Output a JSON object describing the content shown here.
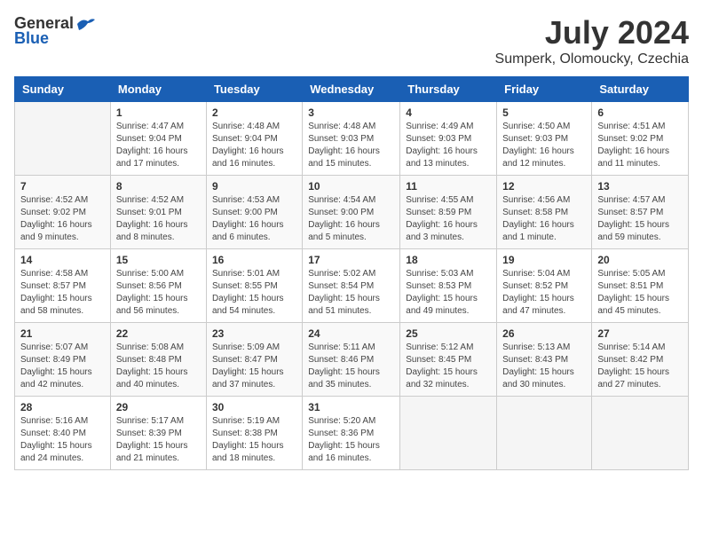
{
  "header": {
    "logo_general": "General",
    "logo_blue": "Blue",
    "month_title": "July 2024",
    "subtitle": "Sumperk, Olomoucky, Czechia"
  },
  "weekdays": [
    "Sunday",
    "Monday",
    "Tuesday",
    "Wednesday",
    "Thursday",
    "Friday",
    "Saturday"
  ],
  "weeks": [
    [
      {
        "day": "",
        "sunrise": "",
        "sunset": "",
        "daylight": ""
      },
      {
        "day": "1",
        "sunrise": "Sunrise: 4:47 AM",
        "sunset": "Sunset: 9:04 PM",
        "daylight": "Daylight: 16 hours and 17 minutes."
      },
      {
        "day": "2",
        "sunrise": "Sunrise: 4:48 AM",
        "sunset": "Sunset: 9:04 PM",
        "daylight": "Daylight: 16 hours and 16 minutes."
      },
      {
        "day": "3",
        "sunrise": "Sunrise: 4:48 AM",
        "sunset": "Sunset: 9:03 PM",
        "daylight": "Daylight: 16 hours and 15 minutes."
      },
      {
        "day": "4",
        "sunrise": "Sunrise: 4:49 AM",
        "sunset": "Sunset: 9:03 PM",
        "daylight": "Daylight: 16 hours and 13 minutes."
      },
      {
        "day": "5",
        "sunrise": "Sunrise: 4:50 AM",
        "sunset": "Sunset: 9:03 PM",
        "daylight": "Daylight: 16 hours and 12 minutes."
      },
      {
        "day": "6",
        "sunrise": "Sunrise: 4:51 AM",
        "sunset": "Sunset: 9:02 PM",
        "daylight": "Daylight: 16 hours and 11 minutes."
      }
    ],
    [
      {
        "day": "7",
        "sunrise": "Sunrise: 4:52 AM",
        "sunset": "Sunset: 9:02 PM",
        "daylight": "Daylight: 16 hours and 9 minutes."
      },
      {
        "day": "8",
        "sunrise": "Sunrise: 4:52 AM",
        "sunset": "Sunset: 9:01 PM",
        "daylight": "Daylight: 16 hours and 8 minutes."
      },
      {
        "day": "9",
        "sunrise": "Sunrise: 4:53 AM",
        "sunset": "Sunset: 9:00 PM",
        "daylight": "Daylight: 16 hours and 6 minutes."
      },
      {
        "day": "10",
        "sunrise": "Sunrise: 4:54 AM",
        "sunset": "Sunset: 9:00 PM",
        "daylight": "Daylight: 16 hours and 5 minutes."
      },
      {
        "day": "11",
        "sunrise": "Sunrise: 4:55 AM",
        "sunset": "Sunset: 8:59 PM",
        "daylight": "Daylight: 16 hours and 3 minutes."
      },
      {
        "day": "12",
        "sunrise": "Sunrise: 4:56 AM",
        "sunset": "Sunset: 8:58 PM",
        "daylight": "Daylight: 16 hours and 1 minute."
      },
      {
        "day": "13",
        "sunrise": "Sunrise: 4:57 AM",
        "sunset": "Sunset: 8:57 PM",
        "daylight": "Daylight: 15 hours and 59 minutes."
      }
    ],
    [
      {
        "day": "14",
        "sunrise": "Sunrise: 4:58 AM",
        "sunset": "Sunset: 8:57 PM",
        "daylight": "Daylight: 15 hours and 58 minutes."
      },
      {
        "day": "15",
        "sunrise": "Sunrise: 5:00 AM",
        "sunset": "Sunset: 8:56 PM",
        "daylight": "Daylight: 15 hours and 56 minutes."
      },
      {
        "day": "16",
        "sunrise": "Sunrise: 5:01 AM",
        "sunset": "Sunset: 8:55 PM",
        "daylight": "Daylight: 15 hours and 54 minutes."
      },
      {
        "day": "17",
        "sunrise": "Sunrise: 5:02 AM",
        "sunset": "Sunset: 8:54 PM",
        "daylight": "Daylight: 15 hours and 51 minutes."
      },
      {
        "day": "18",
        "sunrise": "Sunrise: 5:03 AM",
        "sunset": "Sunset: 8:53 PM",
        "daylight": "Daylight: 15 hours and 49 minutes."
      },
      {
        "day": "19",
        "sunrise": "Sunrise: 5:04 AM",
        "sunset": "Sunset: 8:52 PM",
        "daylight": "Daylight: 15 hours and 47 minutes."
      },
      {
        "day": "20",
        "sunrise": "Sunrise: 5:05 AM",
        "sunset": "Sunset: 8:51 PM",
        "daylight": "Daylight: 15 hours and 45 minutes."
      }
    ],
    [
      {
        "day": "21",
        "sunrise": "Sunrise: 5:07 AM",
        "sunset": "Sunset: 8:49 PM",
        "daylight": "Daylight: 15 hours and 42 minutes."
      },
      {
        "day": "22",
        "sunrise": "Sunrise: 5:08 AM",
        "sunset": "Sunset: 8:48 PM",
        "daylight": "Daylight: 15 hours and 40 minutes."
      },
      {
        "day": "23",
        "sunrise": "Sunrise: 5:09 AM",
        "sunset": "Sunset: 8:47 PM",
        "daylight": "Daylight: 15 hours and 37 minutes."
      },
      {
        "day": "24",
        "sunrise": "Sunrise: 5:11 AM",
        "sunset": "Sunset: 8:46 PM",
        "daylight": "Daylight: 15 hours and 35 minutes."
      },
      {
        "day": "25",
        "sunrise": "Sunrise: 5:12 AM",
        "sunset": "Sunset: 8:45 PM",
        "daylight": "Daylight: 15 hours and 32 minutes."
      },
      {
        "day": "26",
        "sunrise": "Sunrise: 5:13 AM",
        "sunset": "Sunset: 8:43 PM",
        "daylight": "Daylight: 15 hours and 30 minutes."
      },
      {
        "day": "27",
        "sunrise": "Sunrise: 5:14 AM",
        "sunset": "Sunset: 8:42 PM",
        "daylight": "Daylight: 15 hours and 27 minutes."
      }
    ],
    [
      {
        "day": "28",
        "sunrise": "Sunrise: 5:16 AM",
        "sunset": "Sunset: 8:40 PM",
        "daylight": "Daylight: 15 hours and 24 minutes."
      },
      {
        "day": "29",
        "sunrise": "Sunrise: 5:17 AM",
        "sunset": "Sunset: 8:39 PM",
        "daylight": "Daylight: 15 hours and 21 minutes."
      },
      {
        "day": "30",
        "sunrise": "Sunrise: 5:19 AM",
        "sunset": "Sunset: 8:38 PM",
        "daylight": "Daylight: 15 hours and 18 minutes."
      },
      {
        "day": "31",
        "sunrise": "Sunrise: 5:20 AM",
        "sunset": "Sunset: 8:36 PM",
        "daylight": "Daylight: 15 hours and 16 minutes."
      },
      {
        "day": "",
        "sunrise": "",
        "sunset": "",
        "daylight": ""
      },
      {
        "day": "",
        "sunrise": "",
        "sunset": "",
        "daylight": ""
      },
      {
        "day": "",
        "sunrise": "",
        "sunset": "",
        "daylight": ""
      }
    ]
  ]
}
